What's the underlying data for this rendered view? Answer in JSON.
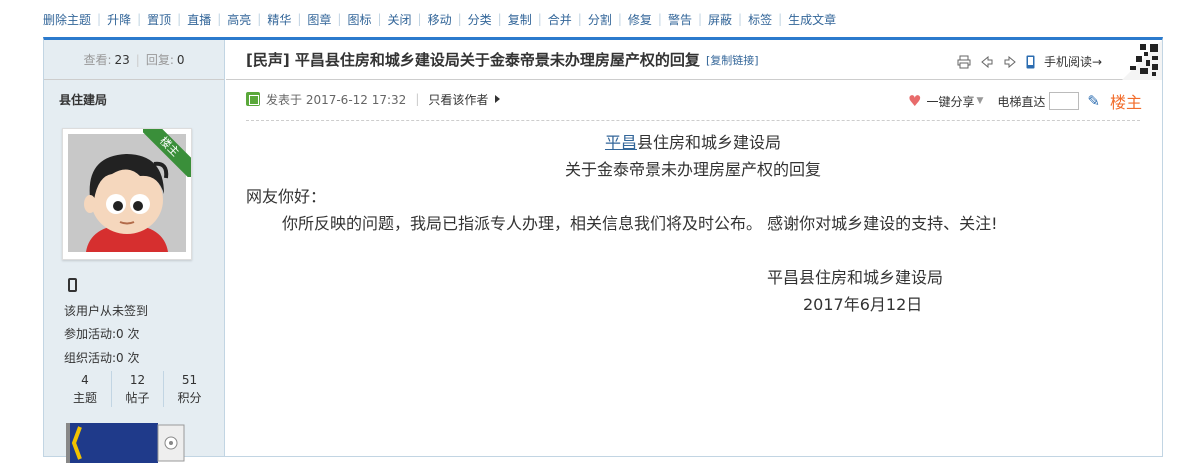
{
  "mod_actions": [
    "删除主题",
    "升降",
    "置顶",
    "直播",
    "高亮",
    "精华",
    "图章",
    "图标",
    "关闭",
    "移动",
    "分类",
    "复制",
    "合并",
    "分割",
    "修复",
    "警告",
    "屏蔽",
    "标签",
    "生成文章"
  ],
  "sidebar": {
    "views_label": "查看:",
    "views": "23",
    "replies_label": "回复:",
    "replies": "0",
    "author": "县住建局",
    "owner_ribbon": "楼主",
    "signin_text": "该用户从未签到",
    "activity_join": "参加活动:0 次",
    "activity_org": "组织活动:0 次",
    "counts": [
      {
        "value": "4",
        "label": "主题"
      },
      {
        "value": "12",
        "label": "帖子"
      },
      {
        "value": "51",
        "label": "积分"
      }
    ]
  },
  "post": {
    "title": "[民声] 平昌县住房和城乡建设局关于金泰帝景未办理房屋产权的回复",
    "copy_link": "[复制链接]",
    "mobile_read": "手机阅读→",
    "posted_at": "发表于 2017-6-12 17:32",
    "author_only": "只看该作者",
    "share": "一键分享",
    "jump_label": "电梯直达",
    "floor": "楼主",
    "content": {
      "heading_link": "平昌",
      "heading_rest": "县住房和城乡建设局",
      "subheading": "关于金泰帝景未办理房屋产权的回复",
      "greeting": "网友你好：",
      "body": "你所反映的问题，我局已指派专人办理，相关信息我们将及时公布。  感谢你对城乡建设的支持、关注!",
      "signature": "平昌县住房和城乡建设局",
      "date": "2017年6月12日"
    }
  },
  "colors": {
    "link": "#336699",
    "accent_border": "#2b7acd",
    "sidebar_bg": "#e5edf2",
    "floor": "#f26c2b"
  },
  "icons": [
    "print-icon",
    "prev-thread-icon",
    "next-thread-icon",
    "mobile-icon",
    "qr-code-icon",
    "post-icon",
    "heart-icon",
    "pencil-icon",
    "phone-icon"
  ]
}
